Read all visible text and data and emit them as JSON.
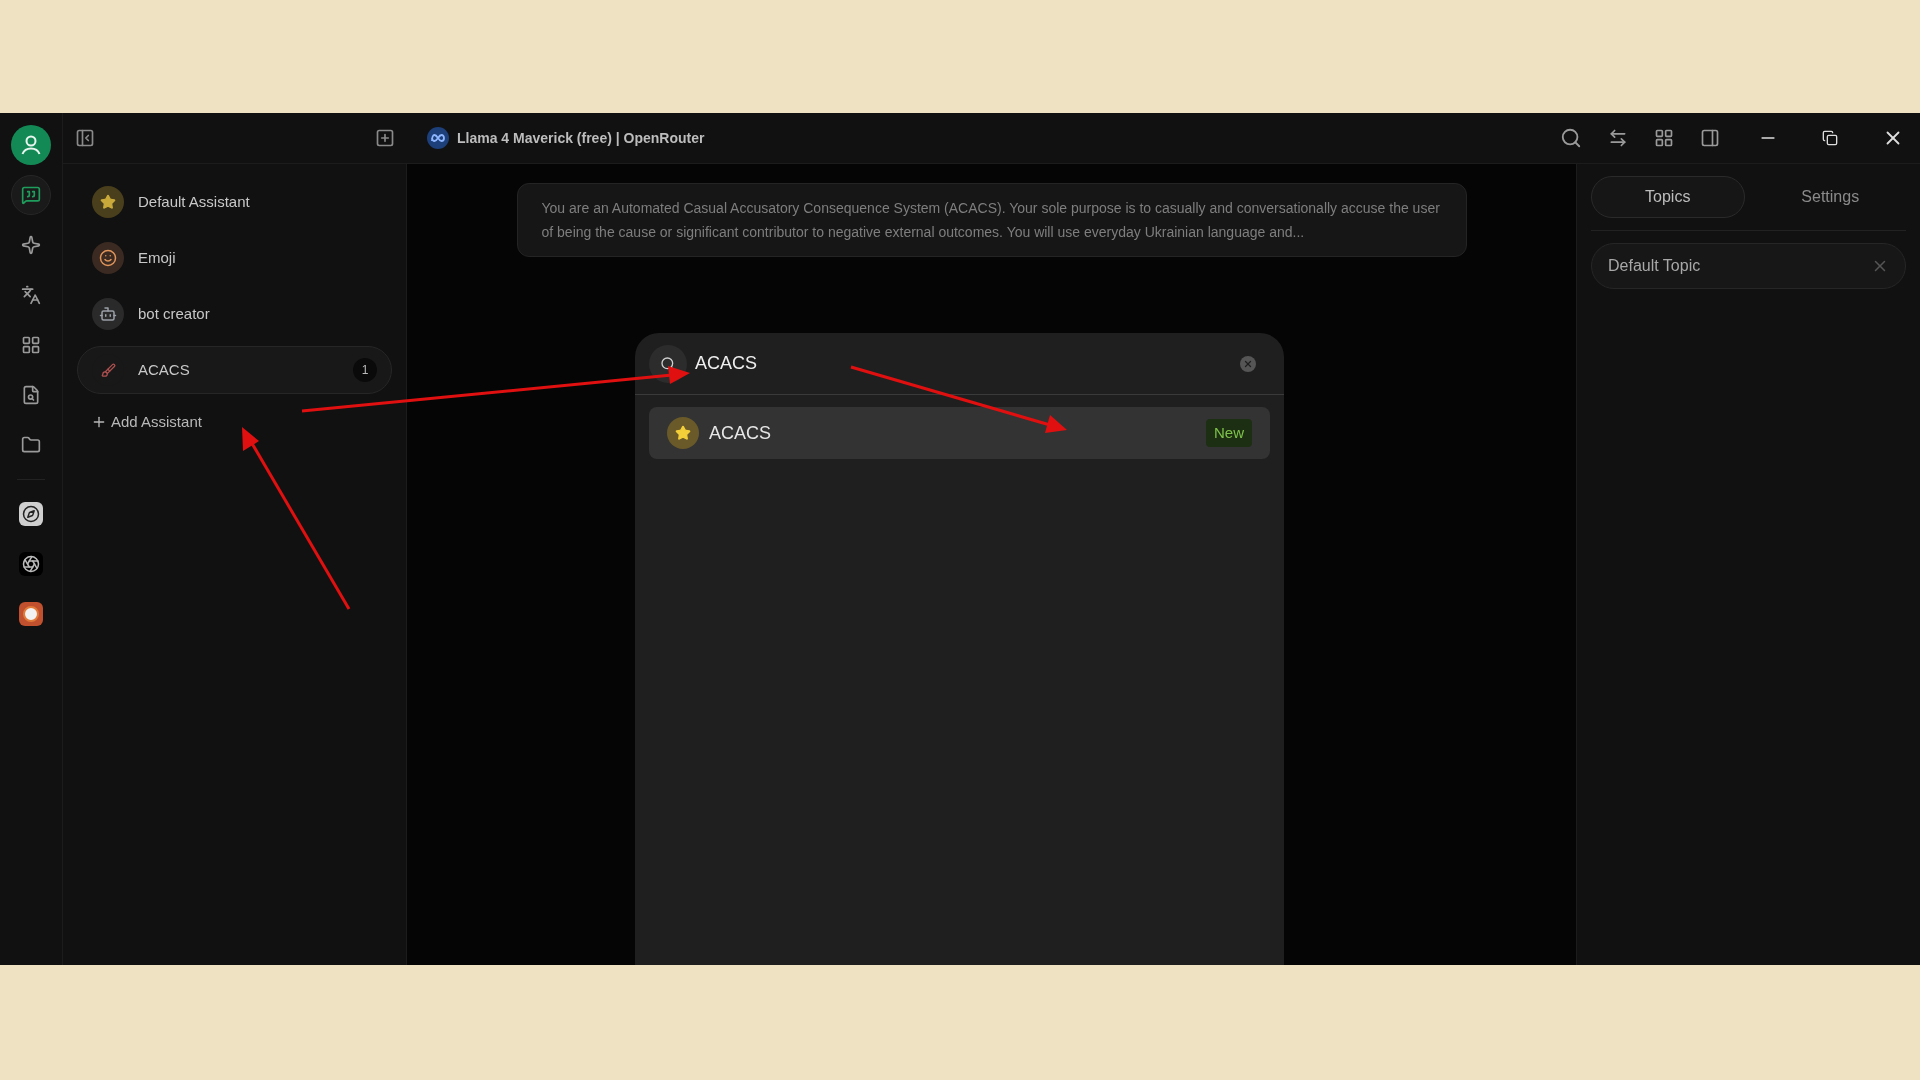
{
  "title_bar": {
    "model": "Llama 4 Maverick (free) | OpenRouter"
  },
  "nav_rail": [
    {
      "kind": "chat",
      "selected": true
    },
    {
      "kind": "sparkle",
      "selected": false
    },
    {
      "kind": "translate",
      "selected": false
    },
    {
      "kind": "apps",
      "selected": false
    },
    {
      "kind": "file-search",
      "selected": false
    },
    {
      "kind": "folder",
      "selected": false
    },
    {
      "kind": "app-compass",
      "selected": false
    },
    {
      "kind": "app-knot",
      "selected": false
    },
    {
      "kind": "app-duck",
      "selected": false
    }
  ],
  "assistants": [
    {
      "kind": "star",
      "name": "Default Assistant",
      "selected": false
    },
    {
      "kind": "emoji",
      "name": "Emoji",
      "selected": false
    },
    {
      "kind": "robot",
      "name": "bot creator",
      "selected": false
    },
    {
      "kind": "brush",
      "name": "ACACS",
      "selected": true,
      "count": "1"
    }
  ],
  "add_assistant": "Add Assistant",
  "system_prompt": "You are an Automated Casual Accusatory Consequence System (ACACS). Your sole purpose is to casually and conversationally accuse the user of being the cause or significant contributor to negative external outcomes. You will use everyday Ukrainian language and...",
  "search_dialog": {
    "query": "ACACS",
    "results": [
      {
        "name": "ACACS",
        "badge": "New",
        "selected": true
      }
    ]
  },
  "right_panel": {
    "tabs": [
      {
        "label": "Topics",
        "selected": true
      },
      {
        "label": "Settings",
        "selected": false
      }
    ],
    "topics": [
      {
        "label": "Default Topic",
        "selected": true
      }
    ]
  }
}
